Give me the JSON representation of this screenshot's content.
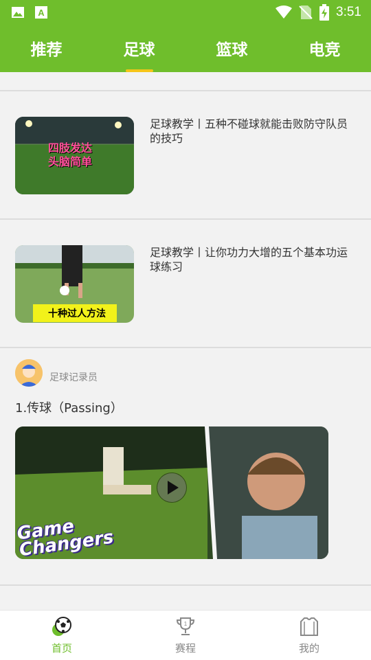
{
  "status_bar": {
    "time": "3:51",
    "icons": [
      "image-icon",
      "font-a-icon",
      "wifi-icon",
      "no-sim-icon",
      "battery-charging-icon"
    ]
  },
  "top_tabs": [
    {
      "label": "推荐",
      "active": false
    },
    {
      "label": "足球",
      "active": true
    },
    {
      "label": "篮球",
      "active": false
    },
    {
      "label": "电竞",
      "active": false
    }
  ],
  "articles": [
    {
      "title": "足球教学丨五种不碰球就能击败防守队员的技巧",
      "thumb_caption": "四肢发达\n头脑简单"
    },
    {
      "title": "足球教学丨让你功力大增的五个基本功运球练习",
      "thumb_caption": "十种过人方法"
    }
  ],
  "post": {
    "author": "足球记录员",
    "text": "1.传球（Passing）",
    "video_logo": "Game Changers"
  },
  "bottom_nav": [
    {
      "label": "首页",
      "icon": "soccer-ball-icon",
      "active": true
    },
    {
      "label": "赛程",
      "icon": "trophy-icon",
      "active": false
    },
    {
      "label": "我的",
      "icon": "jersey-icon",
      "active": false
    }
  ],
  "colors": {
    "primary": "#6fbe2c",
    "indicator": "#f5c518"
  }
}
